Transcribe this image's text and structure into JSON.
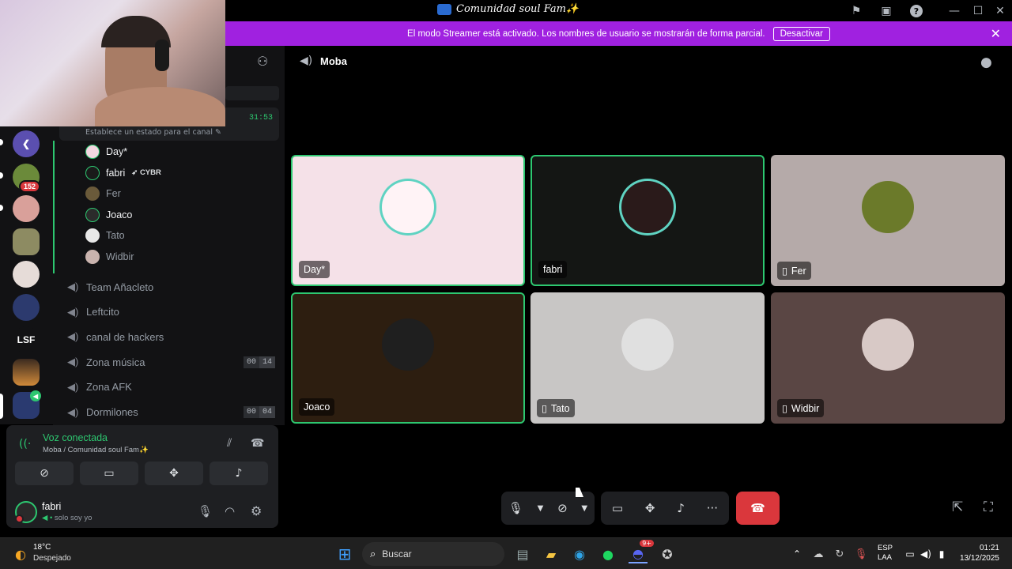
{
  "window": {
    "title": "Comunidad soul Fam✨"
  },
  "banner": {
    "text": "El modo Streamer está activado. Los nombres de usuario se mostrarán de forma parcial.",
    "button": "Desactivar"
  },
  "channels": {
    "status_hint": "Establece un estado para el canal",
    "timer": "31:53",
    "users": [
      {
        "name": "Day*",
        "speaking": true
      },
      {
        "name": "fabri",
        "tag": "CYBR",
        "speaking": true
      },
      {
        "name": "Fer",
        "speaking": false
      },
      {
        "name": "Joaco",
        "speaking": true
      },
      {
        "name": "Tato",
        "speaking": false
      },
      {
        "name": "Widbir",
        "speaking": false
      }
    ],
    "voice_channels": [
      {
        "name": "Team Añacleto"
      },
      {
        "name": "Leftcito"
      },
      {
        "name": "canal de hackers"
      },
      {
        "name": "Zona música",
        "count_a": "00",
        "count_b": "14"
      },
      {
        "name": "Zona AFK"
      },
      {
        "name": "Dormilones",
        "count_a": "00",
        "count_b": "04"
      }
    ]
  },
  "servers": {
    "unread_badge": "152",
    "lsf": "LSF"
  },
  "voice_panel": {
    "status": "Voz conectada",
    "location": "Moba / Comunidad soul Fam✨"
  },
  "user_panel": {
    "name": "fabri",
    "status": "solo soy yo"
  },
  "call": {
    "channel_name": "Moba"
  },
  "tiles": [
    {
      "name": "Day*",
      "mobile": false,
      "speaking": true,
      "bg": "#f5e1e8"
    },
    {
      "name": "fabri",
      "mobile": false,
      "speaking": true,
      "bg": "#141614"
    },
    {
      "name": "Fer",
      "mobile": true,
      "speaking": false,
      "bg": "#b5aaa9"
    },
    {
      "name": "Joaco",
      "mobile": false,
      "speaking": true,
      "bg": "#2d1e10"
    },
    {
      "name": "Tato",
      "mobile": true,
      "speaking": false,
      "bg": "#c8c6c5"
    },
    {
      "name": "Widbir",
      "mobile": true,
      "speaking": false,
      "bg": "#5a4644"
    }
  ],
  "taskbar": {
    "weather_temp": "18°C",
    "weather_desc": "Despejado",
    "search_label": "Buscar",
    "lang_1": "ESP",
    "lang_2": "LAA",
    "time": "01:21",
    "date": "13/12/2025",
    "discord_badge": "9+"
  },
  "colors": {
    "accent_green": "#2dc770",
    "banner_purple": "#a021e0",
    "hangup_red": "#da373c"
  }
}
